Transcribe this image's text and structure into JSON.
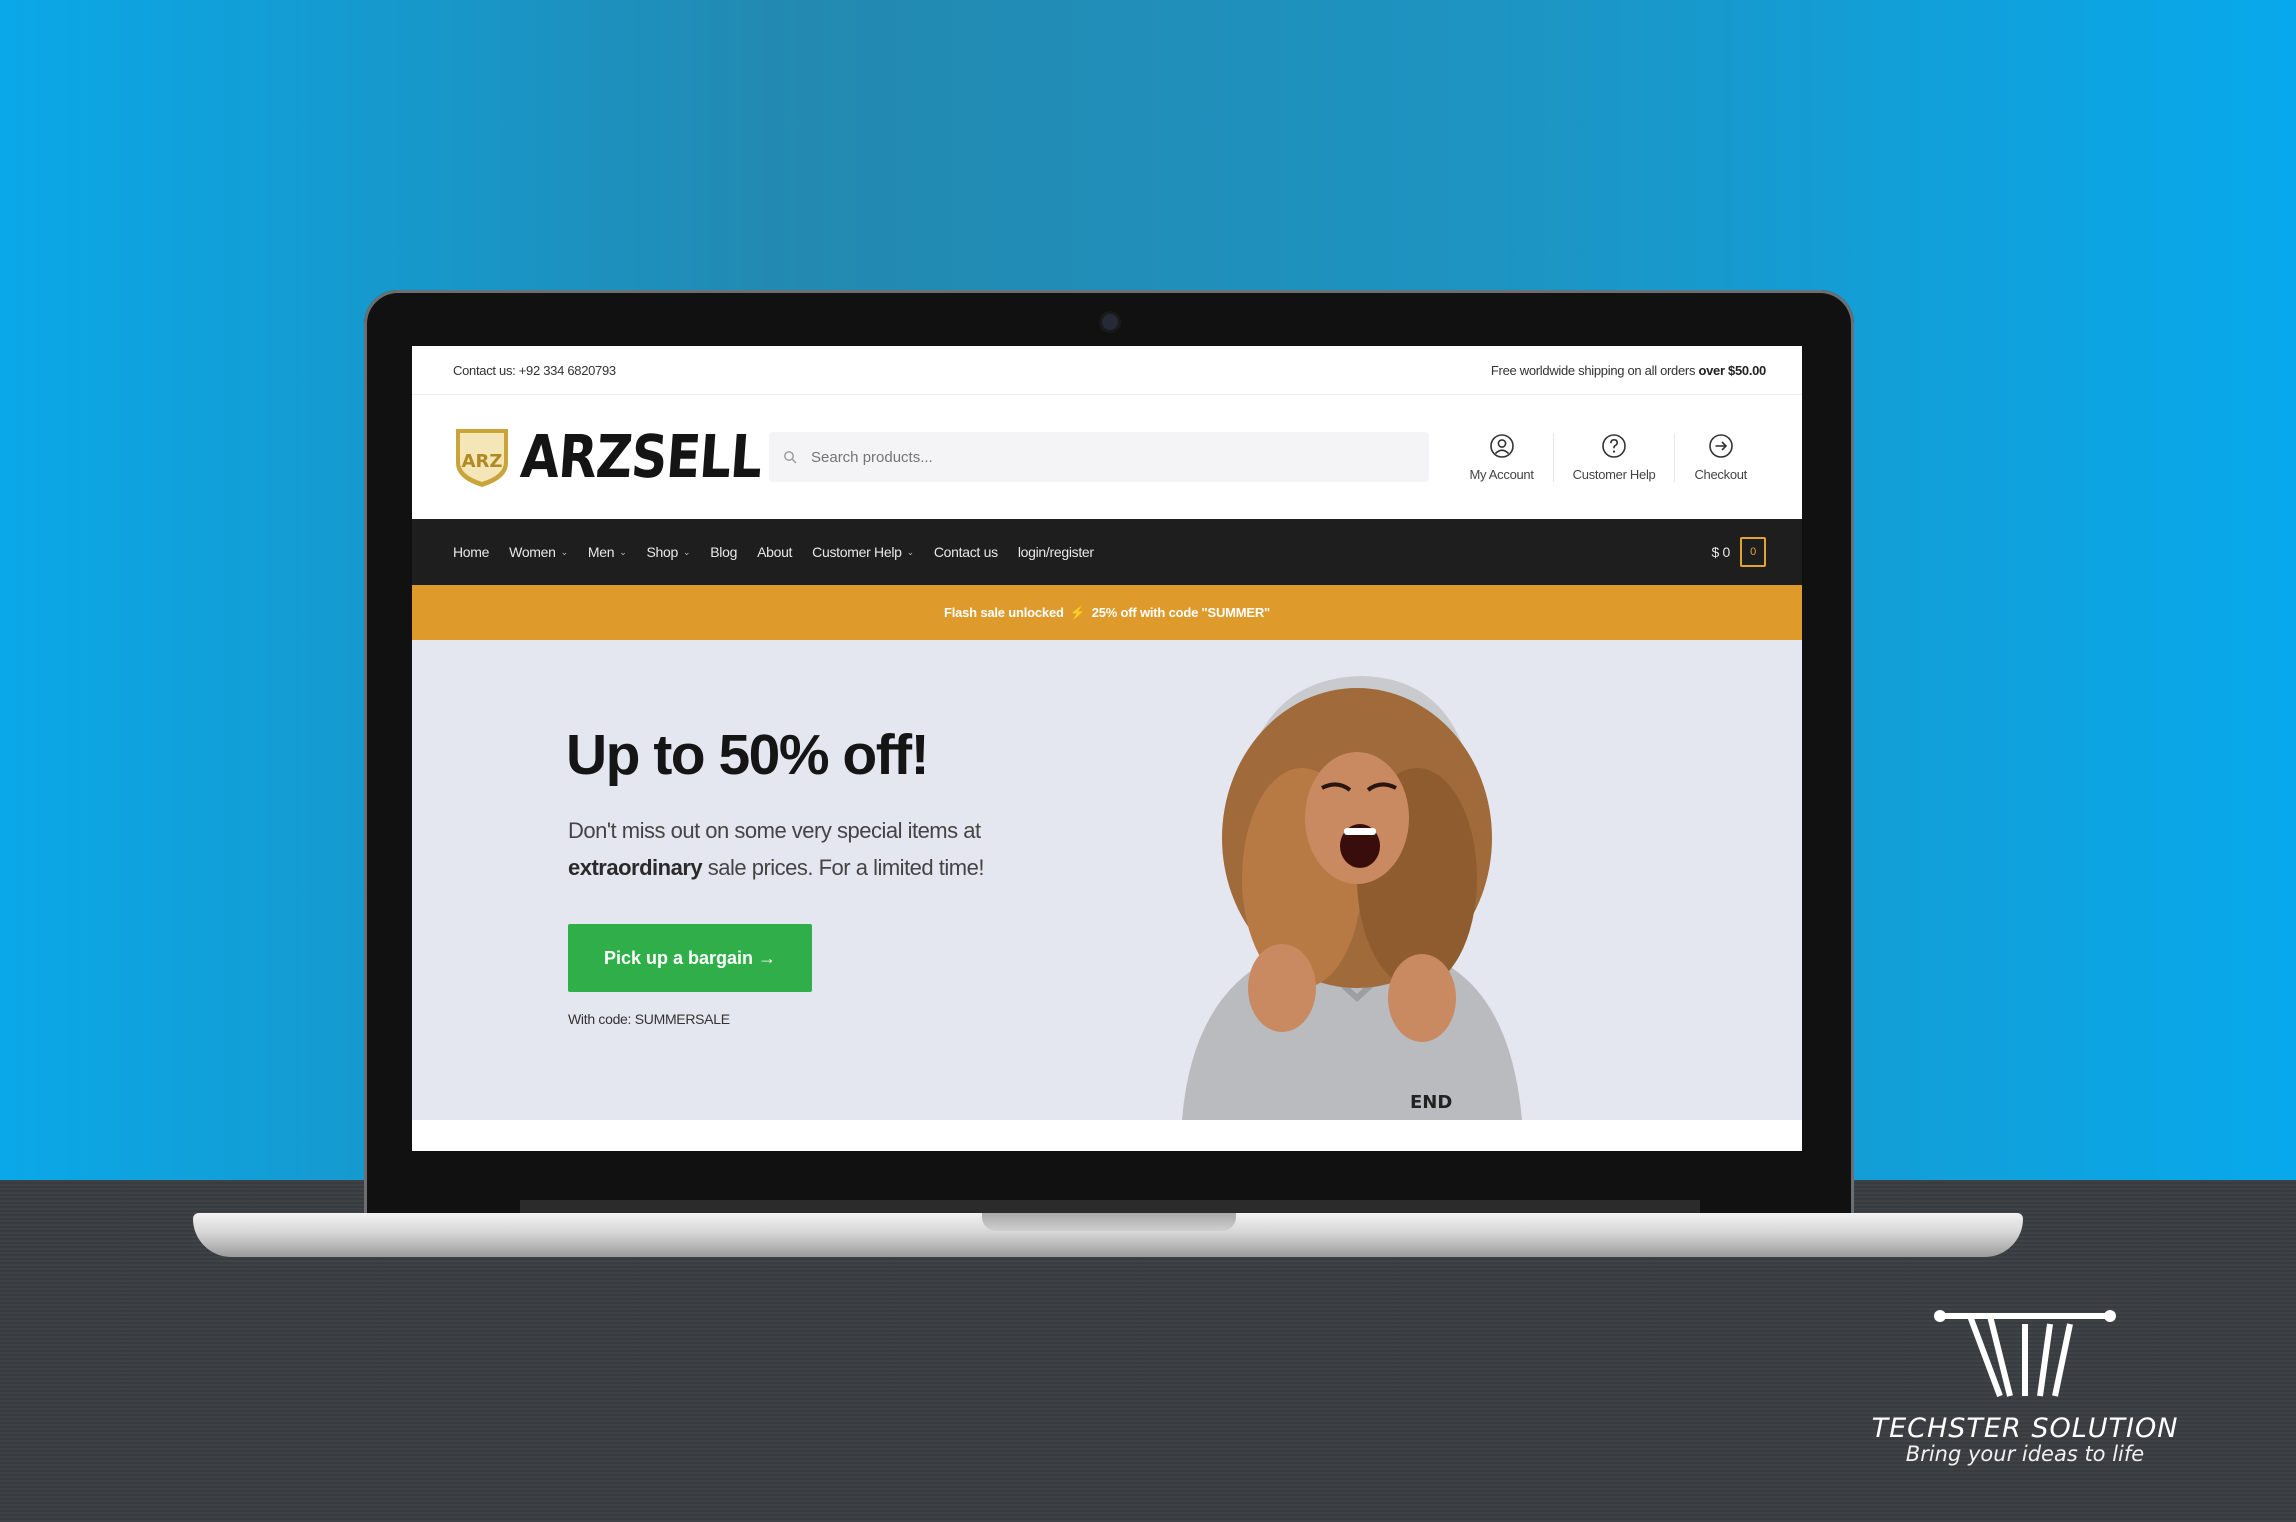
{
  "topbar": {
    "contact": "Contact us: +92 334 6820793",
    "shipping_text": "Free worldwide shipping on all orders ",
    "shipping_bold": "over $50.00"
  },
  "header": {
    "logo_text": "ARZSELL",
    "logo_mark_text": "ARZ",
    "search_placeholder": "Search products...",
    "links": [
      {
        "label": "My Account",
        "icon": "user-icon"
      },
      {
        "label": "Customer Help",
        "icon": "help-icon"
      },
      {
        "label": "Checkout",
        "icon": "checkout-icon"
      }
    ]
  },
  "nav": {
    "items": [
      {
        "label": "Home",
        "dropdown": false
      },
      {
        "label": "Women",
        "dropdown": true
      },
      {
        "label": "Men",
        "dropdown": true
      },
      {
        "label": "Shop",
        "dropdown": true
      },
      {
        "label": "Blog",
        "dropdown": false
      },
      {
        "label": "About",
        "dropdown": false
      },
      {
        "label": "Customer Help",
        "dropdown": true
      },
      {
        "label": "Contact us",
        "dropdown": false
      },
      {
        "label": "login/register",
        "dropdown": false
      }
    ],
    "cart_total": "$ 0",
    "cart_count": "0"
  },
  "promo": {
    "text_before": "Flash sale unlocked",
    "text_after": "25% off with code \"SUMMER\""
  },
  "hero": {
    "title": "Up to 50% off!",
    "text_1": "Don't miss out on some very special items at ",
    "text_bold": "extraordinary",
    "text_2": " sale prices. For a limited time!",
    "cta_label": "Pick up a bargain →",
    "code_text": "With code: SUMMERSALE",
    "shirt_text": "END"
  },
  "brand": {
    "name": "TECHSTER SOLUTION",
    "tagline": "Bring your ideas to life"
  },
  "colors": {
    "background_blue": "#0aa8e8",
    "nav_dark": "#1e1e1e",
    "promo_orange": "#de9a2b",
    "cta_green": "#2fae4a",
    "hero_bg": "#e4e7f0",
    "accent_gold": "#e0a530"
  }
}
